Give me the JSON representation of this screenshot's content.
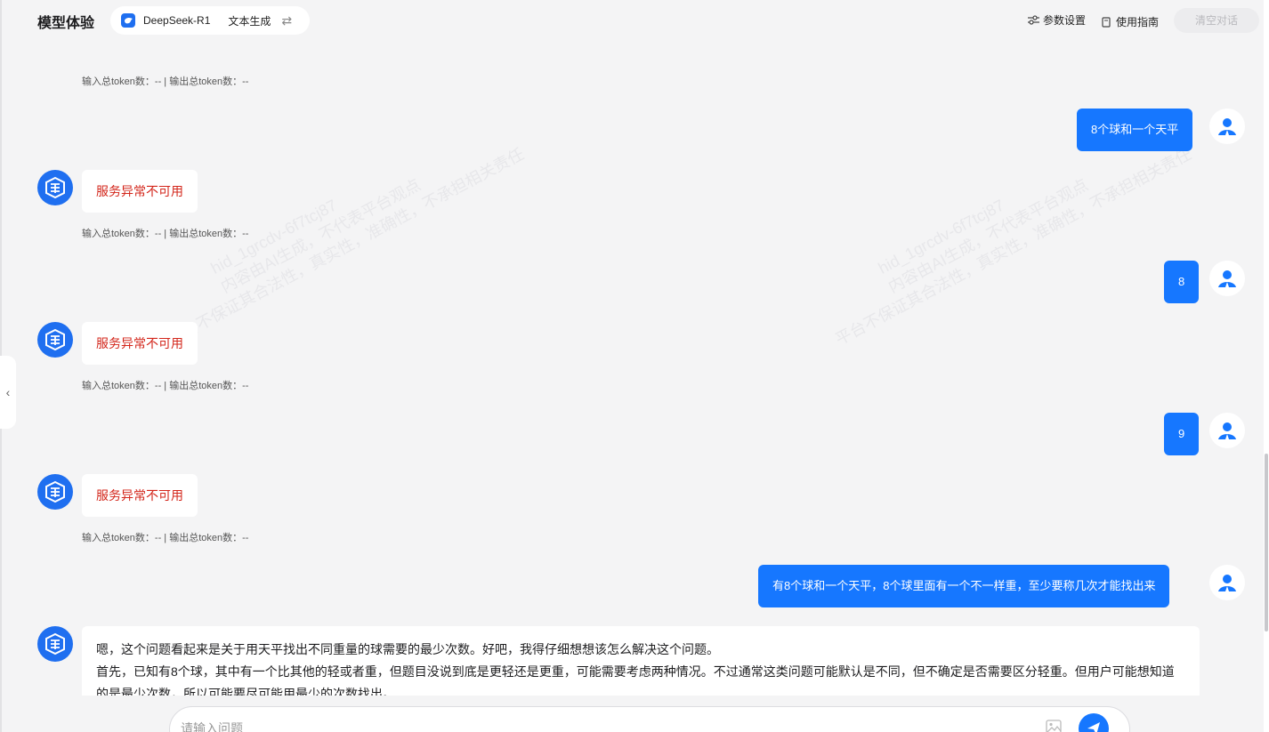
{
  "header": {
    "brand": "模型体验",
    "model_name": "DeepSeek-R1",
    "model_task": "文本生成",
    "params_label": "参数设置",
    "guide_label": "使用指南",
    "clear_label": "清空对话"
  },
  "token_line": "输入总token数：-- | 输出总token数：--",
  "error_text": "服务异常不可用",
  "messages": {
    "user_1": "8个球和一个天平",
    "user_2": "8",
    "user_3": "9",
    "user_4": "有8个球和一个天平，8个球里面有一个不一样重，至少要称几次才能找出来",
    "answer_lines": [
      "嗯，这个问题看起来是关于用天平找出不同重量的球需要的最少次数。好吧，我得仔细想想该怎么解决这个问题。",
      "首先，已知有8个球，其中有一个比其他的轻或者重，但题目没说到底是更轻还是更重，可能需要考虑两种情况。不过通常这类问题可能默认是不同，但不确定是否需要区分轻重。但用户可能想知道",
      "的是最少次数，所以可能要尽可能用最少的次数找出。"
    ]
  },
  "watermark": {
    "line1": "hid_1grcdv-6f7tcj87",
    "line2": "内容由AI生成，不代表平台观点",
    "line3": "平台不保证其合法性，真实性，准确性，不承担相关责任"
  },
  "composer": {
    "placeholder": "请输入问题"
  },
  "colors": {
    "accent": "#1677ff",
    "error": "#d3251a",
    "background": "#f4f4f5"
  }
}
